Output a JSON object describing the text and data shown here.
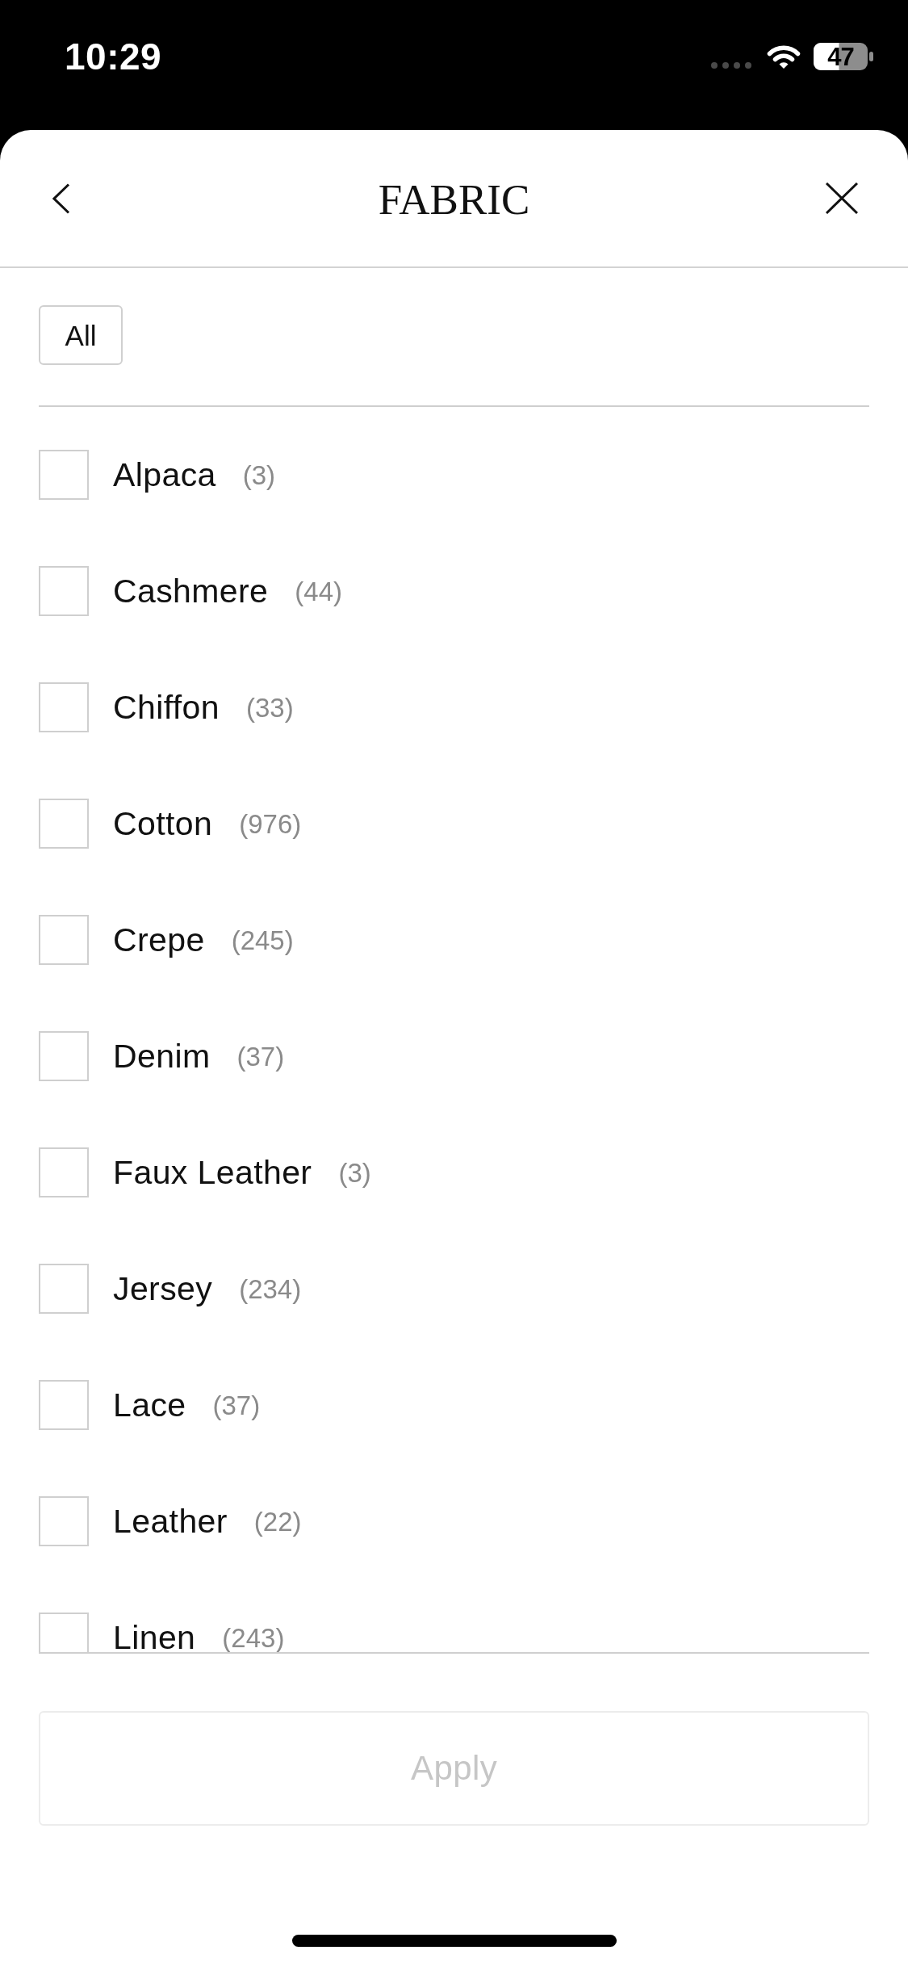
{
  "status_bar": {
    "time": "10:29",
    "battery": "47"
  },
  "header": {
    "title": "FABRIC"
  },
  "all_button": {
    "label": "All"
  },
  "fabrics": [
    {
      "name": "Alpaca",
      "count": "(3)",
      "checked": false
    },
    {
      "name": "Cashmere",
      "count": "(44)",
      "checked": false
    },
    {
      "name": "Chiffon",
      "count": "(33)",
      "checked": false
    },
    {
      "name": "Cotton",
      "count": "(976)",
      "checked": false
    },
    {
      "name": "Crepe",
      "count": "(245)",
      "checked": false
    },
    {
      "name": "Denim",
      "count": "(37)",
      "checked": false
    },
    {
      "name": "Faux Leather",
      "count": "(3)",
      "checked": false
    },
    {
      "name": "Jersey",
      "count": "(234)",
      "checked": false
    },
    {
      "name": "Lace",
      "count": "(37)",
      "checked": false
    },
    {
      "name": "Leather",
      "count": "(22)",
      "checked": false
    },
    {
      "name": "Linen",
      "count": "(243)",
      "checked": false
    }
  ],
  "apply_button": {
    "label": "Apply",
    "disabled": true
  }
}
